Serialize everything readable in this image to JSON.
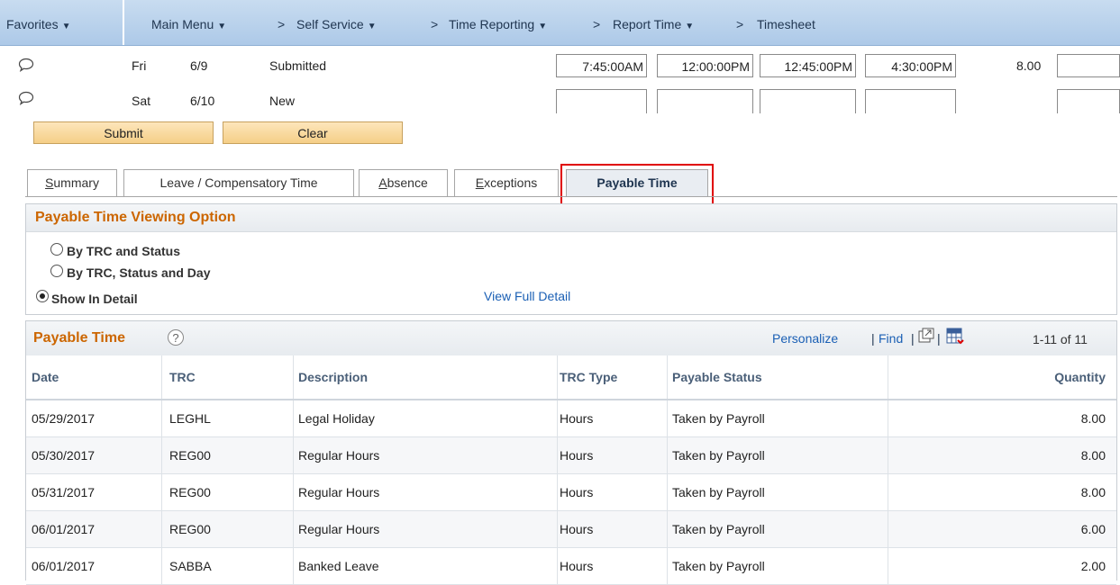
{
  "nav": {
    "favorites": "Favorites",
    "main_menu": "Main Menu",
    "breadcrumb": [
      "Self Service",
      "Time Reporting",
      "Report Time",
      "Timesheet"
    ],
    "separator": ">"
  },
  "timesheet_rows": [
    {
      "day": "Fri",
      "date": "6/9",
      "status": "Submitted",
      "in": "7:45:00AM",
      "lunch_out": "12:00:00PM",
      "lunch_in": "12:45:00PM",
      "out": "4:30:00PM",
      "total": "8.00"
    },
    {
      "day": "Sat",
      "date": "6/10",
      "status": "New",
      "in": "",
      "lunch_out": "",
      "lunch_in": "",
      "out": "",
      "total": ""
    }
  ],
  "buttons": {
    "submit": "Submit",
    "clear": "Clear"
  },
  "tabs": [
    {
      "key": "S",
      "rest": "ummary"
    },
    {
      "pre": "L",
      "rest": "eave / Compensatory Time"
    },
    {
      "key": "A",
      "rest": "bsence"
    },
    {
      "key": "E",
      "rest": "xceptions"
    },
    {
      "label": "Payable Time",
      "selected": true
    }
  ],
  "viewing_option": {
    "title": "Payable Time Viewing Option",
    "options": [
      {
        "label": "By TRC and Status",
        "selected": false
      },
      {
        "label": "By TRC, Status and Day",
        "selected": false
      },
      {
        "label": "Show In Detail",
        "selected": true
      }
    ],
    "view_full_detail": "View Full Detail"
  },
  "payable_time": {
    "title": "Payable Time",
    "personalize": "Personalize",
    "find": "Find",
    "pipe": "|",
    "range": "1-11 of 11",
    "columns": [
      "Date",
      "TRC",
      "Description",
      "TRC Type",
      "Payable Status",
      "Quantity"
    ],
    "rows": [
      [
        "05/29/2017",
        "LEGHL",
        "Legal Holiday",
        "Hours",
        "Taken by Payroll",
        "8.00"
      ],
      [
        "05/30/2017",
        "REG00",
        "Regular Hours",
        "Hours",
        "Taken by Payroll",
        "8.00"
      ],
      [
        "05/31/2017",
        "REG00",
        "Regular Hours",
        "Hours",
        "Taken by Payroll",
        "8.00"
      ],
      [
        "06/01/2017",
        "REG00",
        "Regular Hours",
        "Hours",
        "Taken by Payroll",
        "6.00"
      ],
      [
        "06/01/2017",
        "SABBA",
        "Banked Leave",
        "Hours",
        "Taken by Payroll",
        "2.00"
      ]
    ]
  },
  "colors": {
    "accent_orange": "#cc6600",
    "link_blue": "#1a5fb4",
    "highlight_red": "#e00000"
  }
}
